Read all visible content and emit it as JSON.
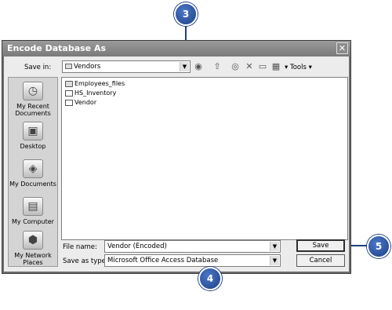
{
  "dialog": {
    "title": "Encode Database As",
    "close_glyph": "✕",
    "save_in_label": "Save in:",
    "save_in_value": "Vendors",
    "tools_label": "Tools",
    "toolbar_icons": [
      "back-icon",
      "up-folder-icon",
      "search-web-icon",
      "delete-icon",
      "new-folder-icon",
      "views-icon"
    ],
    "places": [
      {
        "label": "My Recent Documents",
        "icon": "recent-documents-icon"
      },
      {
        "label": "Desktop",
        "icon": "desktop-icon"
      },
      {
        "label": "My Documents",
        "icon": "my-documents-icon"
      },
      {
        "label": "My Computer",
        "icon": "my-computer-icon"
      },
      {
        "label": "My Network Places",
        "icon": "network-places-icon"
      }
    ],
    "files": [
      {
        "name": "Employees_files",
        "type": "folder"
      },
      {
        "name": "HS_Inventory",
        "type": "database"
      },
      {
        "name": "Vendor",
        "type": "database"
      }
    ],
    "file_name_label": "File name:",
    "file_name_value": "Vendor (Encoded)",
    "save_type_label": "Save as type:",
    "save_type_value": "Microsoft Office Access Database",
    "save_button": "Save",
    "cancel_button": "Cancel"
  },
  "callouts": [
    "3",
    "4",
    "5"
  ],
  "colors": {
    "callout": "#1e3f86",
    "titlebar": "#8a8a8a"
  }
}
